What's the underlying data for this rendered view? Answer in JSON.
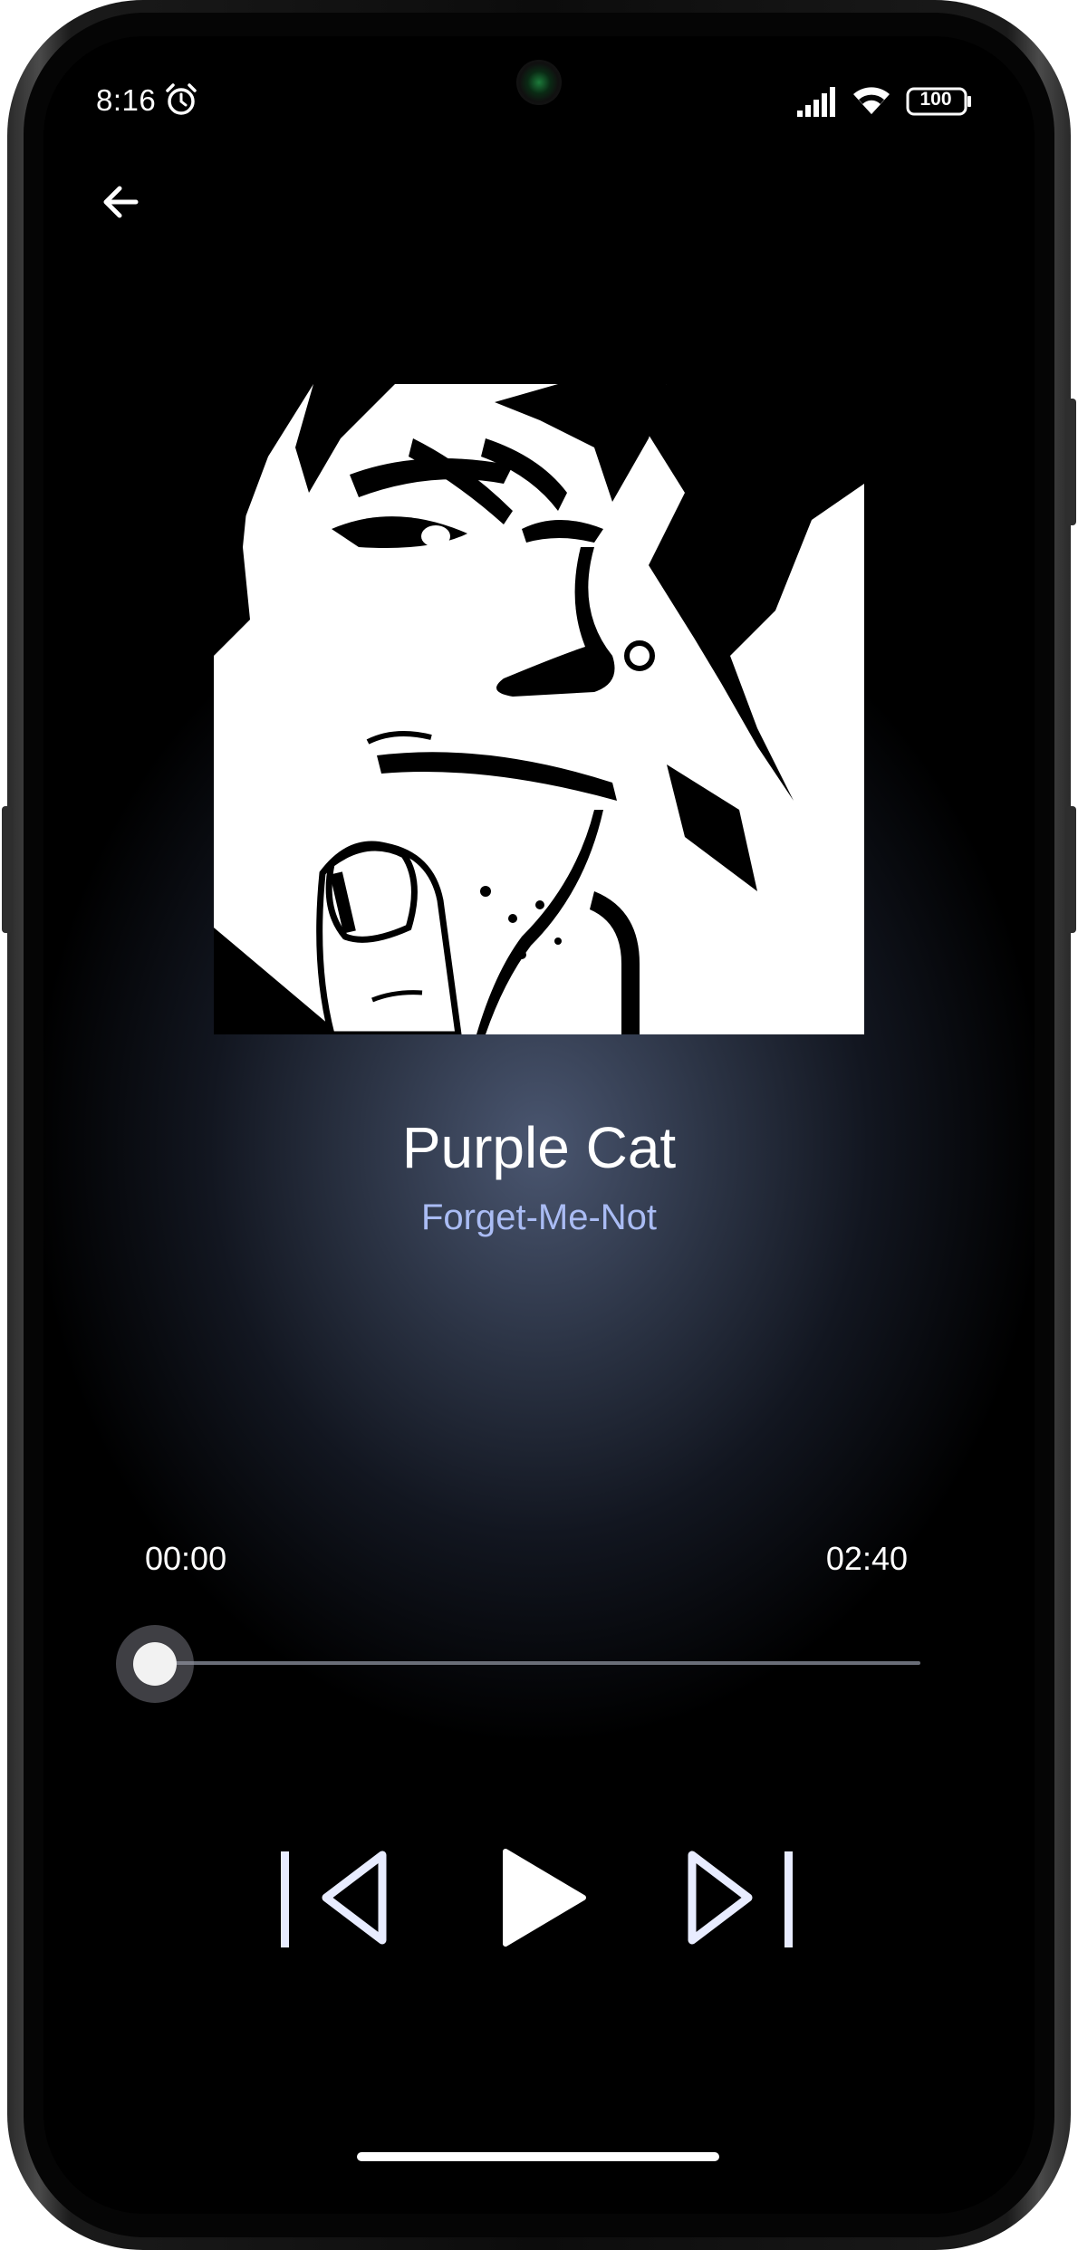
{
  "status_bar": {
    "time": "8:16",
    "battery_level": "100",
    "icons": [
      "alarm-icon",
      "signal-icon",
      "wifi-icon",
      "battery-icon"
    ]
  },
  "navigation": {
    "back_icon": "arrow-left-icon"
  },
  "player": {
    "album_art": "manga-style face illustration",
    "title": "Purple Cat",
    "artist": "Forget-Me-Not",
    "current_time": "00:00",
    "total_time": "02:40",
    "progress": 0,
    "controls": {
      "previous_icon": "skip-previous-icon",
      "play_icon": "play-icon",
      "next_icon": "skip-next-icon"
    }
  },
  "colors": {
    "accent_artist": "#aabcf4",
    "background_glow": "#4a5670",
    "control_icons": "#e8ecff"
  }
}
